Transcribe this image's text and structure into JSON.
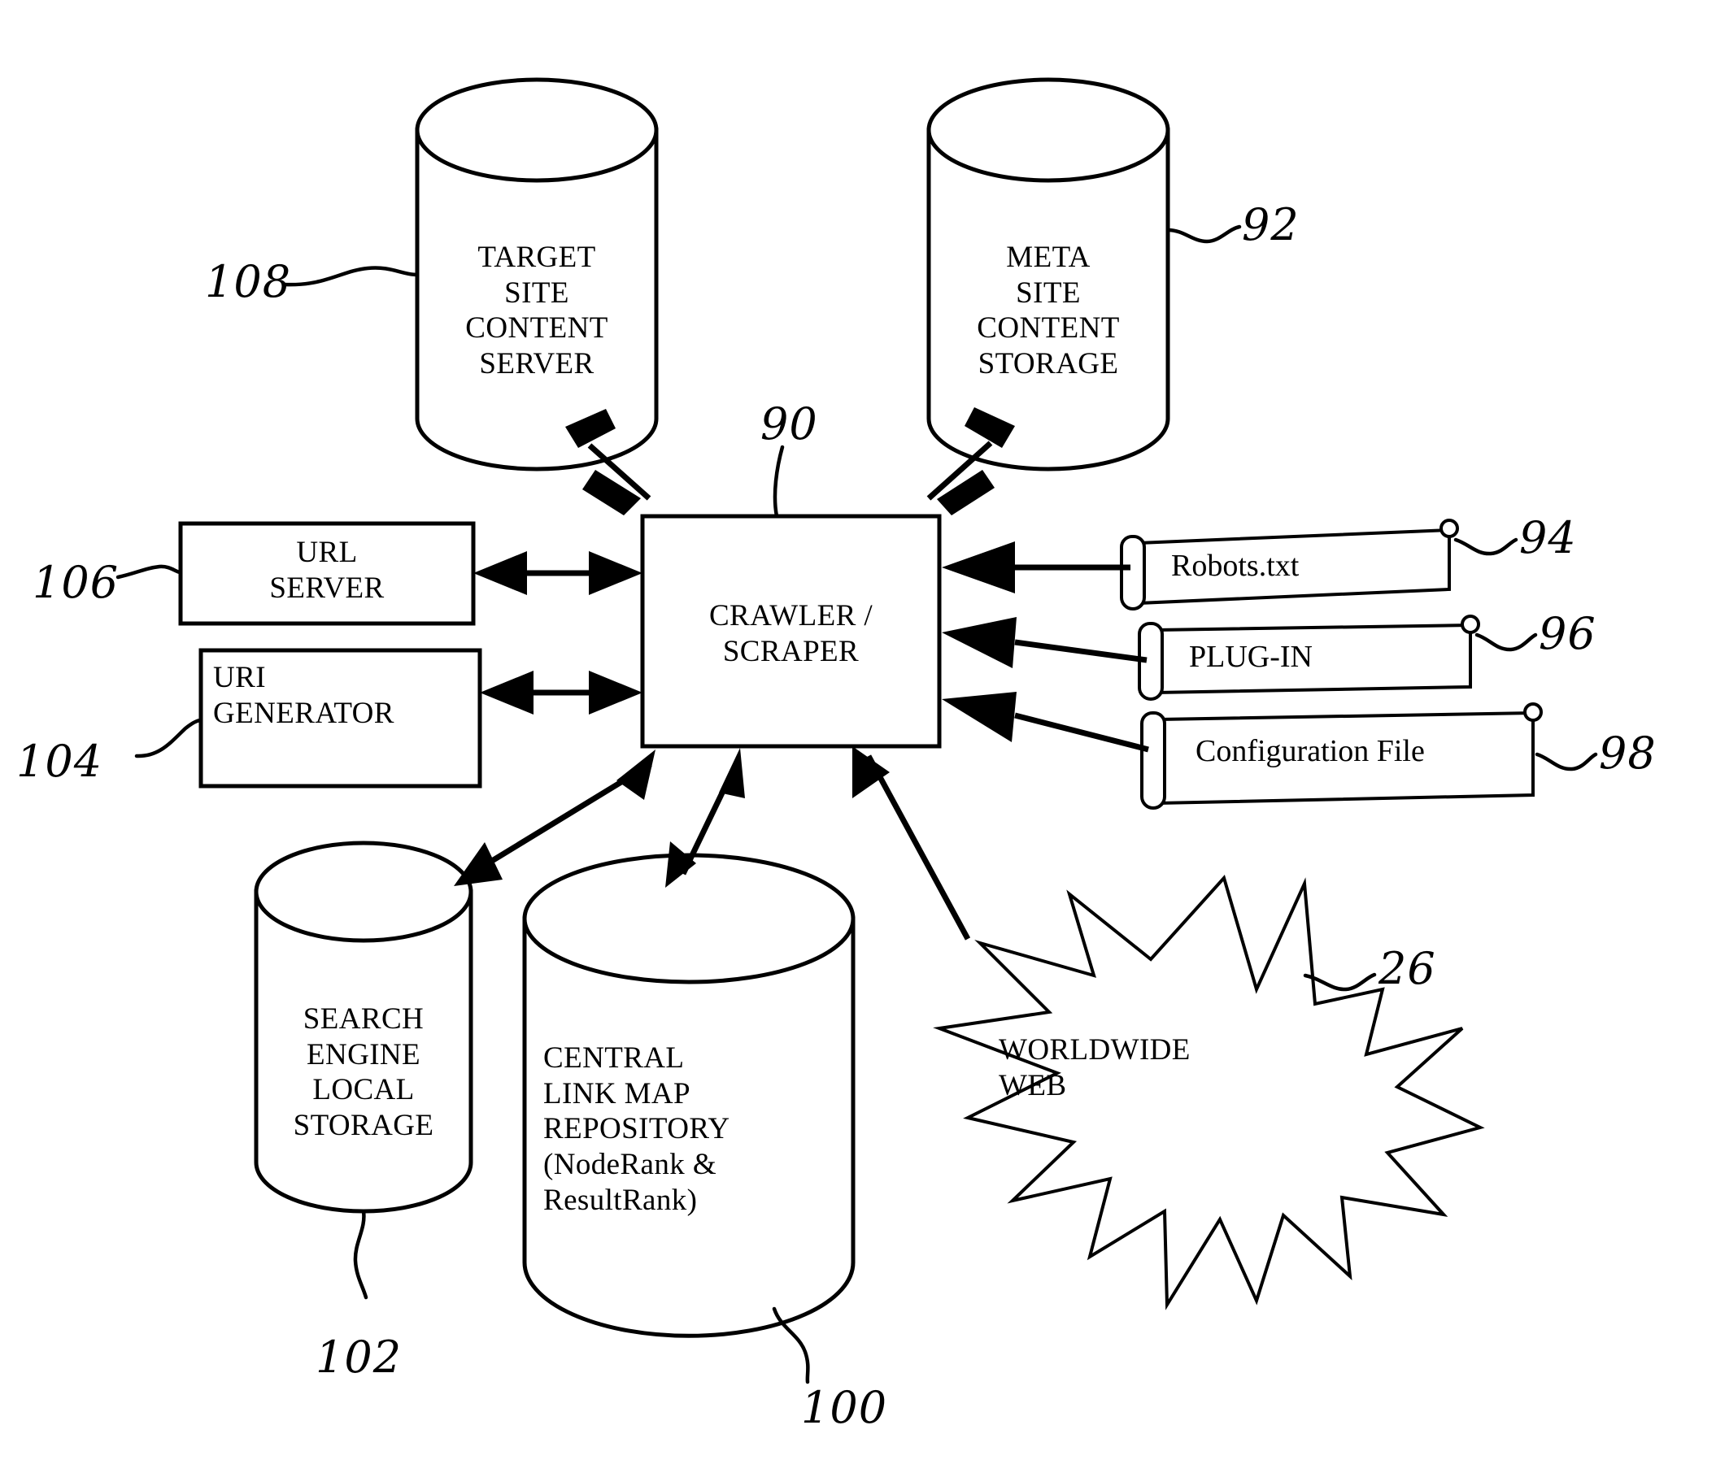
{
  "figure": {
    "title": "Crawler / Scraper system block diagram",
    "line_color": "#000000",
    "background_color": "#ffffff"
  },
  "nodes": {
    "target_site_content_server": {
      "label": "TARGET\nSITE\nCONTENT\nSERVER",
      "shape": "cylinder",
      "ref": "108"
    },
    "meta_site_content_storage": {
      "label": "META\nSITE\nCONTENT\nSTORAGE",
      "shape": "cylinder",
      "ref": "92"
    },
    "crawler_scraper": {
      "label": "CRAWLER /\nSCRAPER",
      "shape": "rectangle",
      "ref": "90"
    },
    "url_server": {
      "label": "URL\nSERVER",
      "shape": "rectangle",
      "ref": "106"
    },
    "uri_generator": {
      "label": "URI\nGENERATOR",
      "shape": "rectangle",
      "ref": "104"
    },
    "robots_txt": {
      "label": "Robots.txt",
      "shape": "scroll",
      "ref": "94"
    },
    "plug_in": {
      "label": "PLUG-IN",
      "shape": "scroll",
      "ref": "96"
    },
    "configuration_file": {
      "label": "Configuration File",
      "shape": "scroll",
      "ref": "98"
    },
    "search_engine_local_storage": {
      "label": "SEARCH\nENGINE\nLOCAL\nSTORAGE",
      "shape": "cylinder",
      "ref": "102"
    },
    "central_link_map_repository": {
      "label": "CENTRAL\nLINK MAP\nREPOSITORY\n(NodeRank &\nResultRank)",
      "shape": "cylinder",
      "ref": "100"
    },
    "worldwide_web": {
      "label": "WORLDWIDE\nWEB",
      "shape": "starburst",
      "ref": "26"
    }
  },
  "connections": [
    {
      "from": "crawler_scraper",
      "to": "target_site_content_server",
      "arrows": "both"
    },
    {
      "from": "crawler_scraper",
      "to": "meta_site_content_storage",
      "arrows": "both"
    },
    {
      "from": "crawler_scraper",
      "to": "url_server",
      "arrows": "both"
    },
    {
      "from": "crawler_scraper",
      "to": "uri_generator",
      "arrows": "both"
    },
    {
      "from": "robots_txt",
      "to": "crawler_scraper",
      "arrows": "single"
    },
    {
      "from": "plug_in",
      "to": "crawler_scraper",
      "arrows": "single"
    },
    {
      "from": "configuration_file",
      "to": "crawler_scraper",
      "arrows": "single"
    },
    {
      "from": "crawler_scraper",
      "to": "search_engine_local_storage",
      "arrows": "both"
    },
    {
      "from": "crawler_scraper",
      "to": "central_link_map_repository",
      "arrows": "both"
    },
    {
      "from": "worldwide_web",
      "to": "crawler_scraper",
      "arrows": "single"
    }
  ]
}
